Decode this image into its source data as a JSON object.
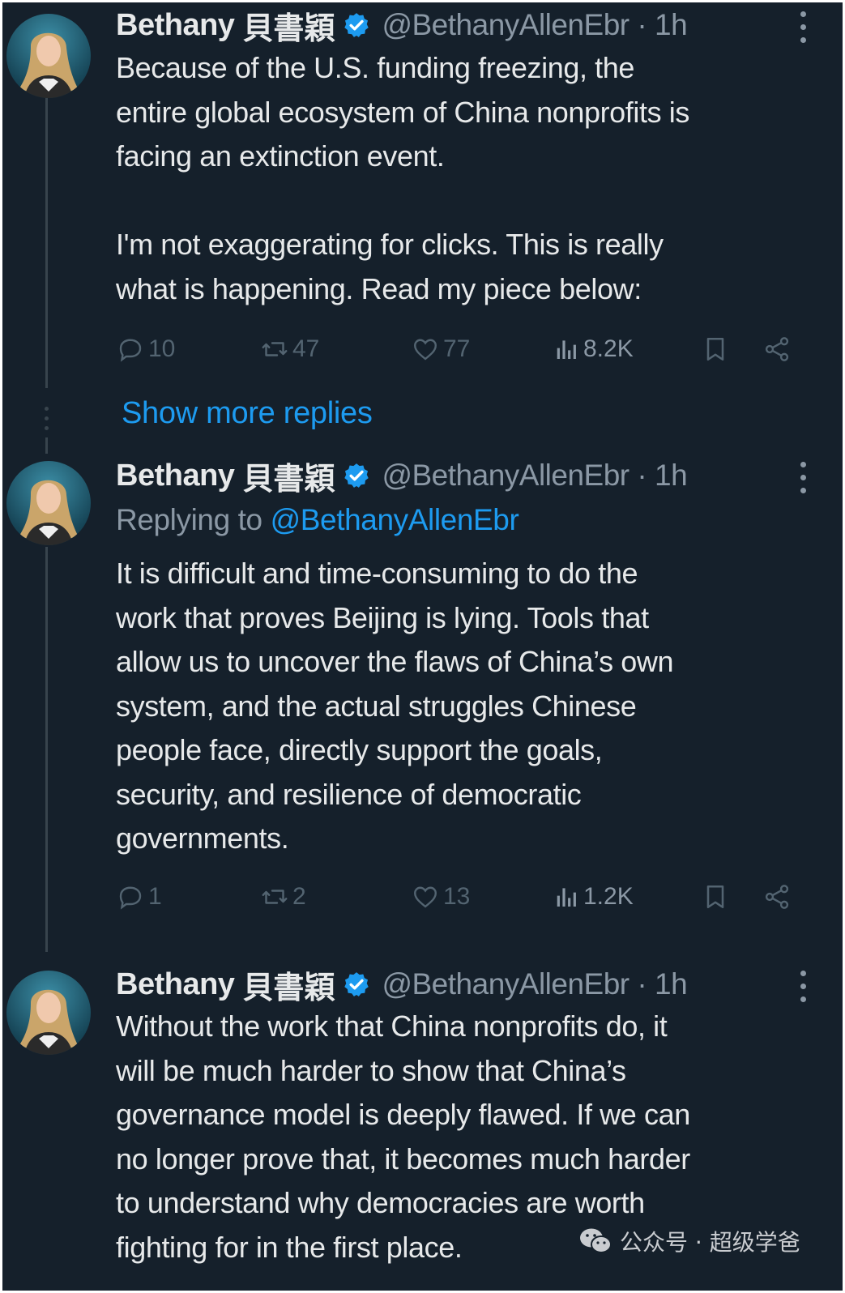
{
  "tweets": [
    {
      "display_name": "Bethany",
      "display_name_cjk": "貝書穎",
      "handle_time": "@BethanyAllenEbr · 1h",
      "replying_prefix": "",
      "replying_handle": "",
      "text": "Because of the U.S. funding freezing, the\nentire global ecosystem of China nonprofits is\nfacing an extinction event.\n\nI'm not exaggerating for clicks. This is really\nwhat is happening. Read my piece below:",
      "replies": "10",
      "retweets": "47",
      "likes": "77",
      "views": "8.2K"
    },
    {
      "display_name": "Bethany",
      "display_name_cjk": "貝書穎",
      "handle_time": "@BethanyAllenEbr · 1h",
      "replying_prefix": "Replying to ",
      "replying_handle": "@BethanyAllenEbr",
      "text": "It is difficult and time-consuming to do the\nwork that proves Beijing is lying. Tools that\nallow us to uncover the flaws of China’s own\nsystem, and the actual struggles Chinese\npeople face, directly support the goals,\nsecurity, and resilience of democratic\ngovernments.",
      "replies": "1",
      "retweets": "2",
      "likes": "13",
      "views": "1.2K"
    },
    {
      "display_name": "Bethany",
      "display_name_cjk": "貝書穎",
      "handle_time": "@BethanyAllenEbr · 1h",
      "replying_prefix": "",
      "replying_handle": "",
      "text": "Without the work that China nonprofits do, it\nwill be much harder to show that China’s\ngovernance model is deeply flawed. If we can\nno longer prove that, it becomes much harder\nto understand why democracies are worth\nfighting for in the first place.",
      "replies": "",
      "retweets": "",
      "likes": "",
      "views": ""
    }
  ],
  "show_more_replies": "Show more replies",
  "watermark": "公众号 · 超级学爸",
  "colors": {
    "background": "#15202b",
    "text": "#e7e9ea",
    "secondary": "#8b98a5",
    "accent": "#1d9bf0",
    "thread_line": "#38444d"
  },
  "icons": [
    "verified-badge-icon",
    "more-options-icon",
    "reply-icon",
    "retweet-icon",
    "like-icon",
    "views-icon",
    "bookmark-icon",
    "share-icon",
    "wechat-icon"
  ]
}
